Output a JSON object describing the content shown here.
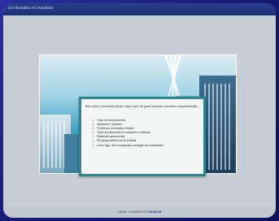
{
  "window": {
    "title": "ria informática IV: Hardware"
  },
  "dialog": {
    "intro": "Bem-vindo à presente edição. Aqui, você vai poder explorar conceitos computacionais:",
    "items": [
      "Tipos de computadores",
      "Hardware e software",
      "Periféricos de entrada e saída",
      "Tipos de elementos de hardware e software",
      "Sistemas operacionais",
      "Principais periféricos de entrada",
      "Como ligar, abrir programas e desligar um computador"
    ]
  },
  "footer": {
    "prefix": "Clique e arraste em",
    "action": "Avançar"
  },
  "colors": {
    "background": "#1a1f7a",
    "titlebar": "#2a3f8f",
    "dialog_border": "#2d8791",
    "workspace": "#c8ced5"
  }
}
